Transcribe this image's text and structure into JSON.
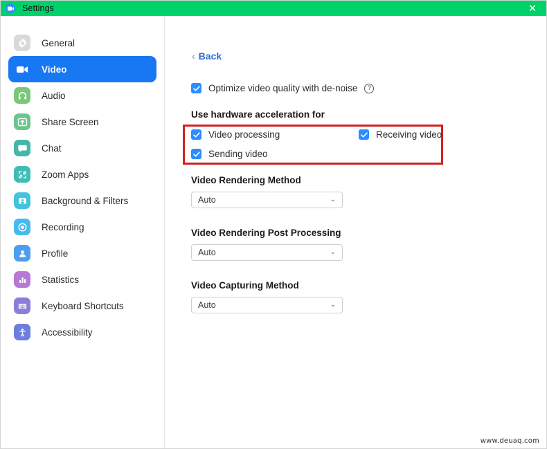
{
  "window": {
    "title": "Settings",
    "app_icon": "video-camera-icon",
    "close_label": "✕",
    "titlebar_color": "#00d26a",
    "accent_color": "#2d8cff"
  },
  "sidebar": {
    "items": [
      {
        "label": "General",
        "icon": "gear-icon",
        "icon_color": "#d9d9d9",
        "selected": false
      },
      {
        "label": "Video",
        "icon": "video-camera-icon",
        "icon_color": "#1877f2",
        "selected": true
      },
      {
        "label": "Audio",
        "icon": "headphones-icon",
        "icon_color": "#7ac77a",
        "selected": false
      },
      {
        "label": "Share Screen",
        "icon": "share-screen-icon",
        "icon_color": "#6cc48f",
        "selected": false
      },
      {
        "label": "Chat",
        "icon": "chat-bubble-icon",
        "icon_color": "#45b7a8",
        "selected": false
      },
      {
        "label": "Zoom Apps",
        "icon": "zoom-apps-icon",
        "icon_color": "#3fbcb6",
        "selected": false
      },
      {
        "label": "Background & Filters",
        "icon": "person-frame-icon",
        "icon_color": "#44c3dd",
        "selected": false
      },
      {
        "label": "Recording",
        "icon": "record-circle-icon",
        "icon_color": "#46b9ef",
        "selected": false
      },
      {
        "label": "Profile",
        "icon": "person-icon",
        "icon_color": "#4d9ef0",
        "selected": false
      },
      {
        "label": "Statistics",
        "icon": "bar-chart-icon",
        "icon_color": "#b77ad4",
        "selected": false
      },
      {
        "label": "Keyboard Shortcuts",
        "icon": "keyboard-icon",
        "icon_color": "#8a7fd8",
        "selected": false
      },
      {
        "label": "Accessibility",
        "icon": "accessibility-icon",
        "icon_color": "#6d7ee0",
        "selected": false
      }
    ]
  },
  "content": {
    "back": {
      "label": "Back",
      "chevron": "‹"
    },
    "optimize": {
      "label": "Optimize video quality with de-noise",
      "checked": true,
      "help_icon": "question-mark-icon",
      "help_glyph": "?"
    },
    "hardware_acceleration": {
      "heading": "Use hardware acceleration for",
      "highlight_color": "#d31f1f",
      "options": [
        {
          "label": "Video processing",
          "checked": true
        },
        {
          "label": "Sending video",
          "checked": true
        },
        {
          "label": "Receiving video",
          "checked": true
        }
      ]
    },
    "fields": [
      {
        "label": "Video Rendering Method",
        "value": "Auto",
        "caret": "⌄"
      },
      {
        "label": "Video Rendering Post Processing",
        "value": "Auto",
        "caret": "⌄"
      },
      {
        "label": "Video Capturing Method",
        "value": "Auto",
        "caret": "⌄"
      }
    ]
  },
  "watermark": {
    "text": "www.deuaq.com"
  }
}
